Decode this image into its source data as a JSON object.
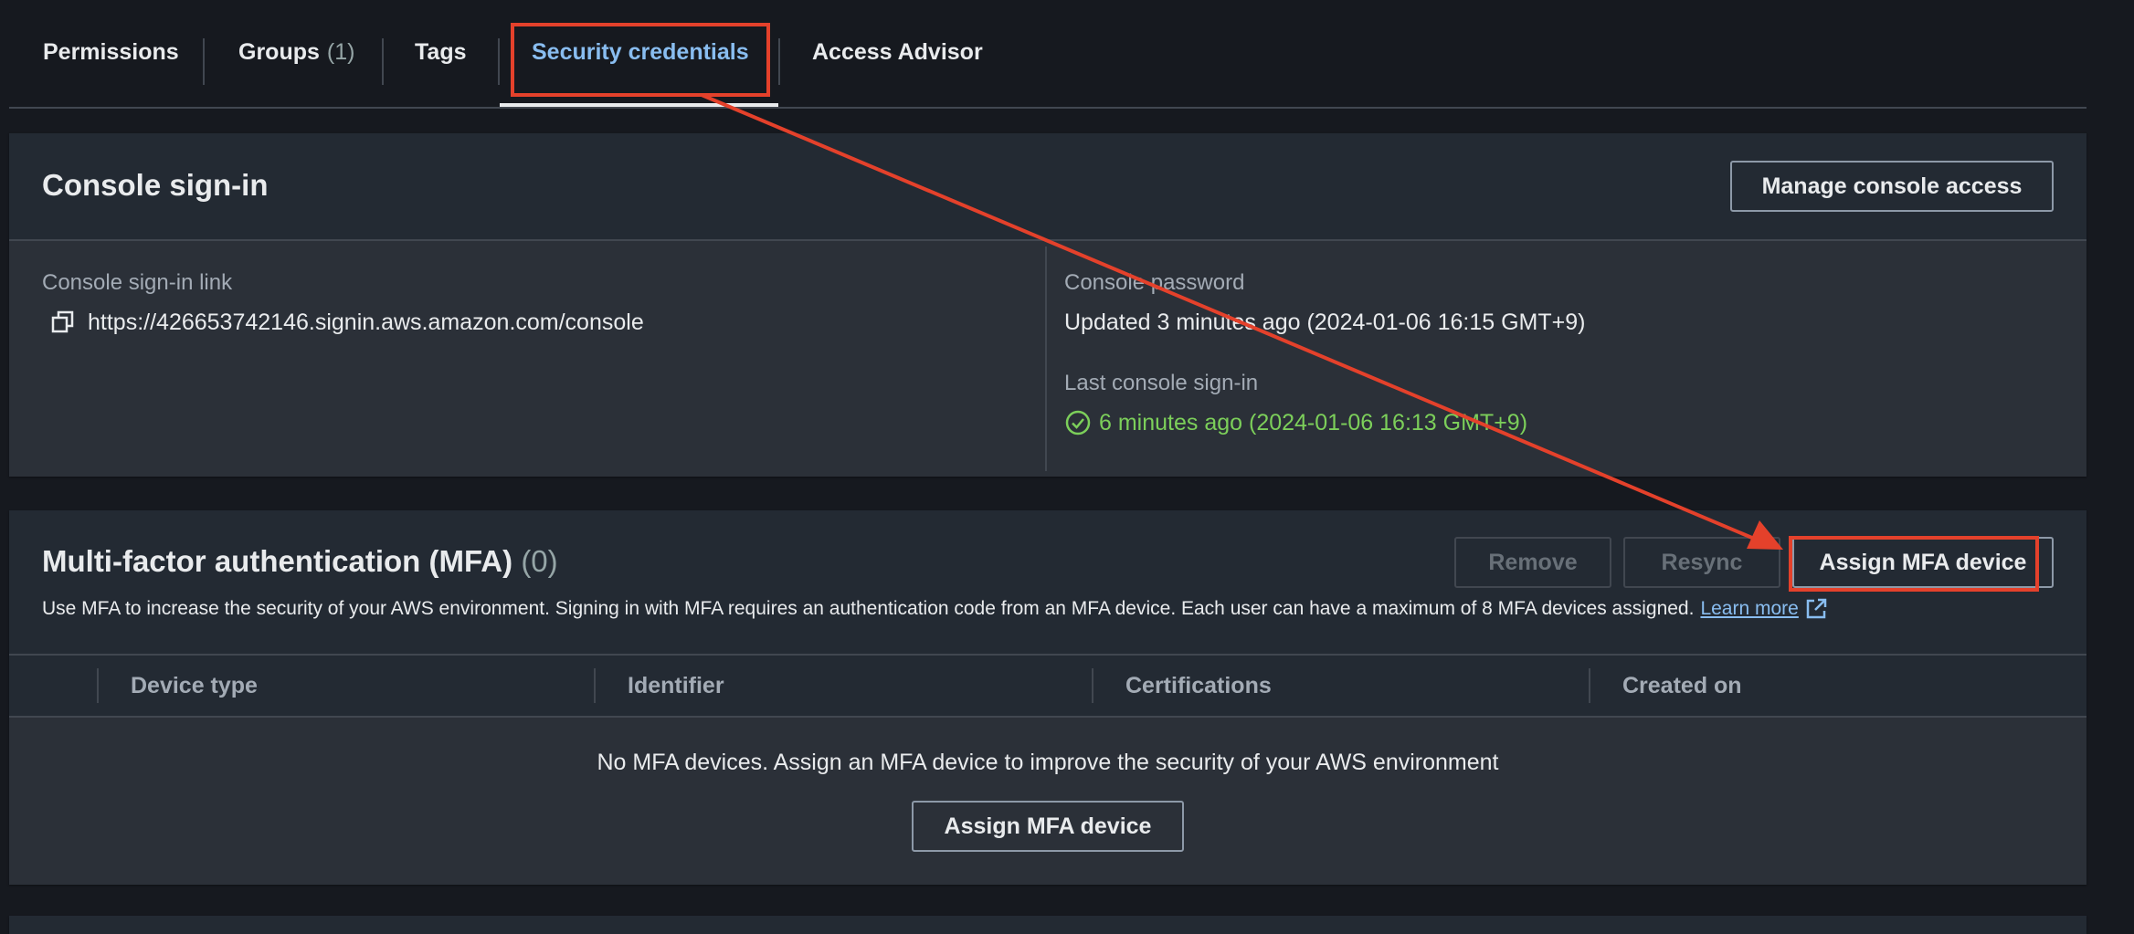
{
  "tabs": [
    {
      "label": "Permissions"
    },
    {
      "label": "Groups",
      "count": "(1)"
    },
    {
      "label": "Tags"
    },
    {
      "label": "Security credentials",
      "active": true
    },
    {
      "label": "Access Advisor"
    }
  ],
  "console_signin": {
    "title": "Console sign-in",
    "manage_button": "Manage console access",
    "link_label": "Console sign-in link",
    "link_value": "https://426653742146.signin.aws.amazon.com/console",
    "password_label": "Console password",
    "password_value": "Updated 3 minutes ago (2024-01-06 16:15 GMT+9)",
    "last_signin_label": "Last console sign-in",
    "last_signin_value": "6 minutes ago (2024-01-06 16:13 GMT+9)"
  },
  "mfa": {
    "title": "Multi-factor authentication (MFA)",
    "count": "(0)",
    "remove_button": "Remove",
    "resync_button": "Resync",
    "assign_button": "Assign MFA device",
    "description": "Use MFA to increase the security of your AWS environment. Signing in with MFA requires an authentication code from an MFA device. Each user can have a maximum of 8 MFA devices assigned.",
    "learn_more": "Learn more",
    "columns": [
      "Device type",
      "Identifier",
      "Certifications",
      "Created on"
    ],
    "empty_message": "No MFA devices. Assign an MFA device to improve the security of your AWS environment",
    "empty_assign_button": "Assign MFA device"
  },
  "colors": {
    "background": "#16191f",
    "panel": "#232a33",
    "active_tab": "#89bdf0",
    "success": "#7ccf5a",
    "link": "#89bdf0",
    "annotation": "#e4412b"
  },
  "icons": [
    "copy-icon",
    "status-success-icon",
    "external-link-icon"
  ]
}
